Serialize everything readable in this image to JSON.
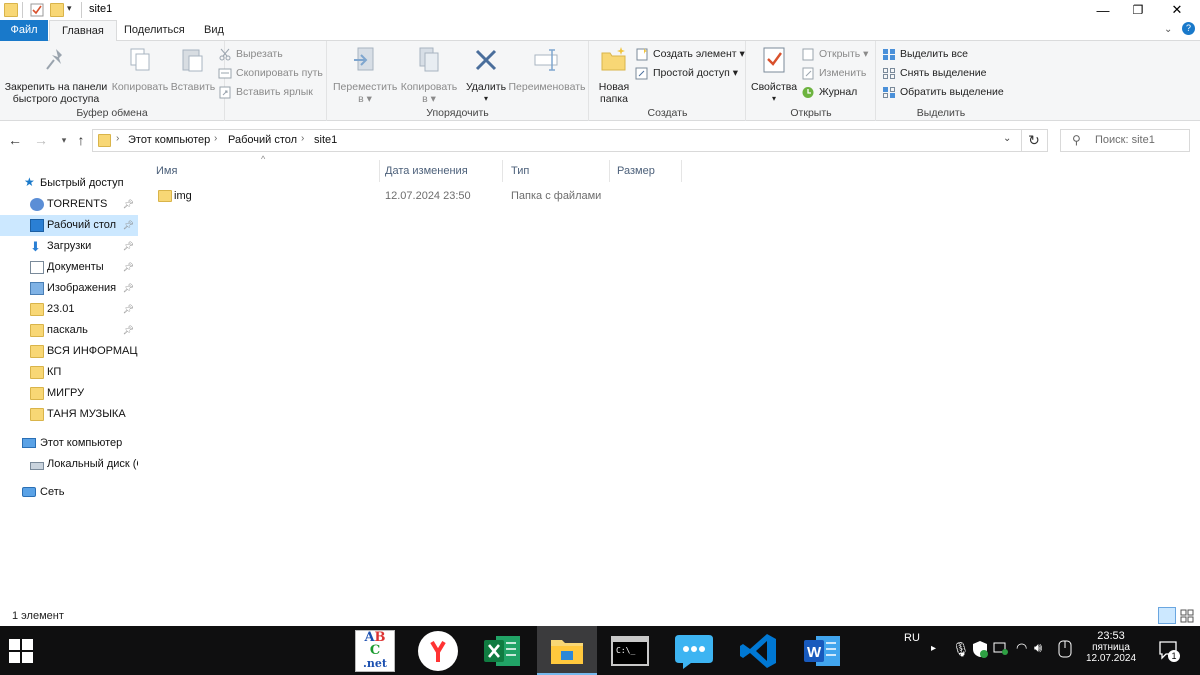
{
  "window": {
    "title": "site1",
    "controls": {
      "minimize": "—",
      "maximize": "❐",
      "close": "✕"
    }
  },
  "ribbon_tabs": [
    {
      "label": "Файл",
      "kind": "file"
    },
    {
      "label": "Главная",
      "active": true
    },
    {
      "label": "Поделиться"
    },
    {
      "label": "Вид"
    }
  ],
  "ribbon": {
    "clipboard": {
      "label": "Буфер обмена",
      "pin": "Закрепить на панели быстрого доступа",
      "pin_line1": "Закрепить на панели",
      "pin_line2": "быстрого доступа",
      "copy": "Копировать",
      "paste": "Вставить",
      "cut": "Вырезать",
      "copy_path": "Скопировать путь",
      "paste_shortcut": "Вставить ярлык"
    },
    "organize": {
      "label": "Упорядочить",
      "move_to_l1": "Переместить",
      "move_to_l2": "в",
      "copy_to_l1": "Копировать",
      "copy_to_l2": "в",
      "delete": "Удалить",
      "rename": "Переименовать"
    },
    "create": {
      "label": "Создать",
      "new_folder_l1": "Новая",
      "new_folder_l2": "папка",
      "new_item": "Создать элемент",
      "easy_access": "Простой доступ"
    },
    "open": {
      "label": "Открыть",
      "properties": "Свойства",
      "open": "Открыть",
      "edit": "Изменить",
      "history": "Журнал"
    },
    "select": {
      "label": "Выделить",
      "select_all": "Выделить все",
      "select_none": "Снять выделение",
      "invert": "Обратить выделение"
    }
  },
  "address": {
    "crumbs": [
      "Этот компьютер",
      "Рабочий стол",
      "site1"
    ],
    "search_placeholder": "Поиск: site1"
  },
  "nav_pane": {
    "items": [
      {
        "label": "Быстрый доступ",
        "icon": "star-icon",
        "level": 0
      },
      {
        "label": "TORRENTS",
        "icon": "torrent-icon",
        "level": 1,
        "pinned": true
      },
      {
        "label": "Рабочий стол",
        "icon": "desktop-icon",
        "level": 1,
        "pinned": true,
        "selected": true
      },
      {
        "label": "Загрузки",
        "icon": "download-icon",
        "level": 1,
        "pinned": true
      },
      {
        "label": "Документы",
        "icon": "documents-icon",
        "level": 1,
        "pinned": true
      },
      {
        "label": "Изображения",
        "icon": "pictures-icon",
        "level": 1,
        "pinned": true
      },
      {
        "label": "23.01",
        "icon": "folder-icon",
        "level": 1,
        "pinned": true
      },
      {
        "label": "паскаль",
        "icon": "folder-icon",
        "level": 1,
        "pinned": true
      },
      {
        "label": "ВСЯ ИНФОРМАЦИ",
        "icon": "folder-icon",
        "level": 1
      },
      {
        "label": "КП",
        "icon": "folder-icon",
        "level": 1
      },
      {
        "label": "МИГРУ",
        "icon": "folder-icon",
        "level": 1
      },
      {
        "label": "ТАНЯ МУЗЫКА",
        "icon": "folder-icon",
        "level": 1
      },
      {
        "label": "Этот компьютер",
        "icon": "computer-icon",
        "level": 0
      },
      {
        "label": "Локальный диск (С",
        "icon": "drive-icon",
        "level": 1
      },
      {
        "label": "Сеть",
        "icon": "network-icon",
        "level": 0
      }
    ]
  },
  "file_list": {
    "columns": [
      "Имя",
      "Дата изменения",
      "Тип",
      "Размер"
    ],
    "rows": [
      {
        "name": "img",
        "modified": "12.07.2024 23:50",
        "type": "Папка с файлами",
        "size": ""
      }
    ]
  },
  "status_bar": {
    "item_count": "1 элемент"
  },
  "taskbar": {
    "apps": [
      {
        "name": "abcnet-app",
        "active": false
      },
      {
        "name": "yandex-browser-app",
        "active": false
      },
      {
        "name": "excel-app",
        "active": false
      },
      {
        "name": "file-explorer-app",
        "active": true
      },
      {
        "name": "cmd-app",
        "active": false
      },
      {
        "name": "messenger-app",
        "active": false
      },
      {
        "name": "vscode-app",
        "active": false
      },
      {
        "name": "word-app",
        "active": false
      }
    ],
    "language": "RU",
    "time": "23:53",
    "weekday": "пятница",
    "date": "12.07.2024",
    "notification_count": "1"
  },
  "colors": {
    "accent": "#1979ca",
    "selection": "#cce8ff",
    "folder": "#f8d775",
    "taskbar": "#0f0f10"
  }
}
